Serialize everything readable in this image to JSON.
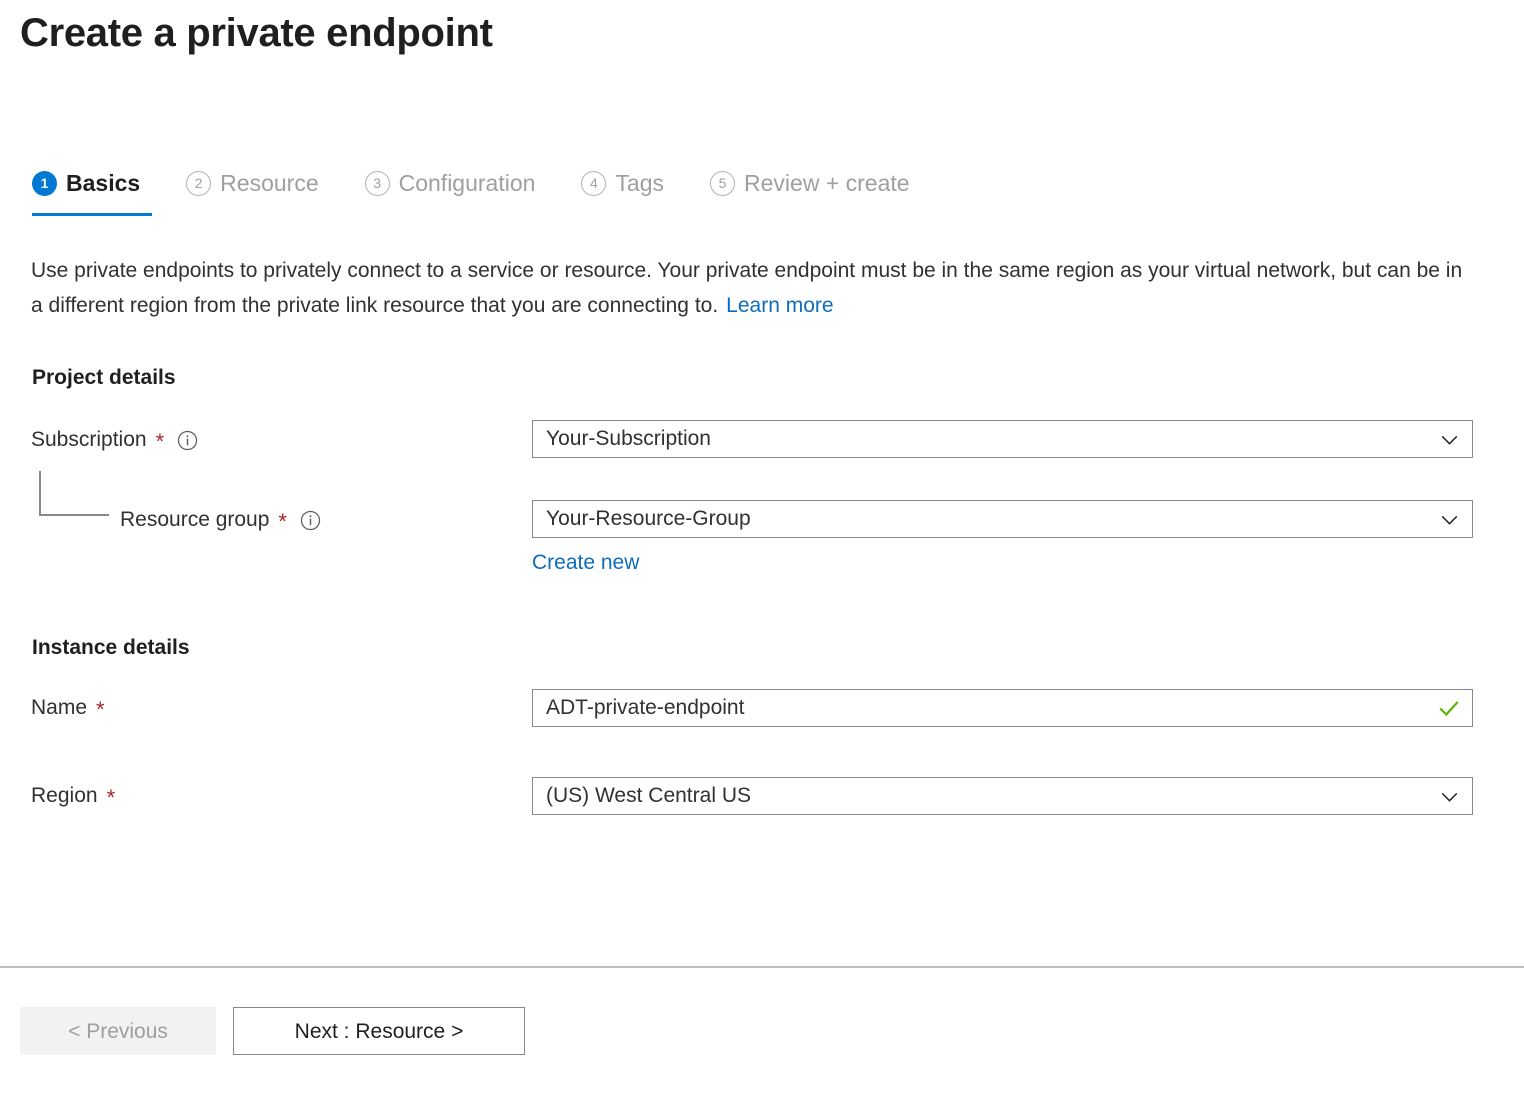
{
  "page": {
    "title": "Create a private endpoint"
  },
  "wizard": {
    "tabs": [
      {
        "number": "1",
        "label": "Basics",
        "state": "active"
      },
      {
        "number": "2",
        "label": "Resource",
        "state": "inactive"
      },
      {
        "number": "3",
        "label": "Configuration",
        "state": "inactive"
      },
      {
        "number": "4",
        "label": "Tags",
        "state": "inactive"
      },
      {
        "number": "5",
        "label": "Review + create",
        "state": "inactive"
      }
    ],
    "active_index": 0,
    "accent_color": "#0078d4"
  },
  "description": {
    "text": "Use private endpoints to privately connect to a service or resource. Your private endpoint must be in the same region as your virtual network, but can be in a different region from the private link resource that you are connecting to.",
    "link_label": "Learn more",
    "link_color": "#0f6cbd"
  },
  "project_details": {
    "heading": "Project details",
    "subscription": {
      "label": "Subscription",
      "required": "*",
      "info_icon": "info-icon",
      "value": "Your-Subscription",
      "control": "dropdown"
    },
    "resource_group": {
      "label": "Resource group",
      "required": "*",
      "info_icon": "info-icon",
      "value": "Your-Resource-Group",
      "control": "dropdown",
      "create_new_label": "Create new"
    }
  },
  "instance_details": {
    "heading": "Instance details",
    "name": {
      "label": "Name",
      "required": "*",
      "value": "ADT-private-endpoint",
      "control": "textbox",
      "validation_icon": "checkmark-icon",
      "validation_color": "#5db300"
    },
    "region": {
      "label": "Region",
      "required": "*",
      "value": "(US) West Central US",
      "control": "dropdown"
    }
  },
  "footer": {
    "previous_label": "< Previous",
    "previous_disabled": true,
    "next_label": "Next : Resource >"
  },
  "icons": {
    "required_star": "*",
    "chevron_down": "chevron-down-icon"
  }
}
